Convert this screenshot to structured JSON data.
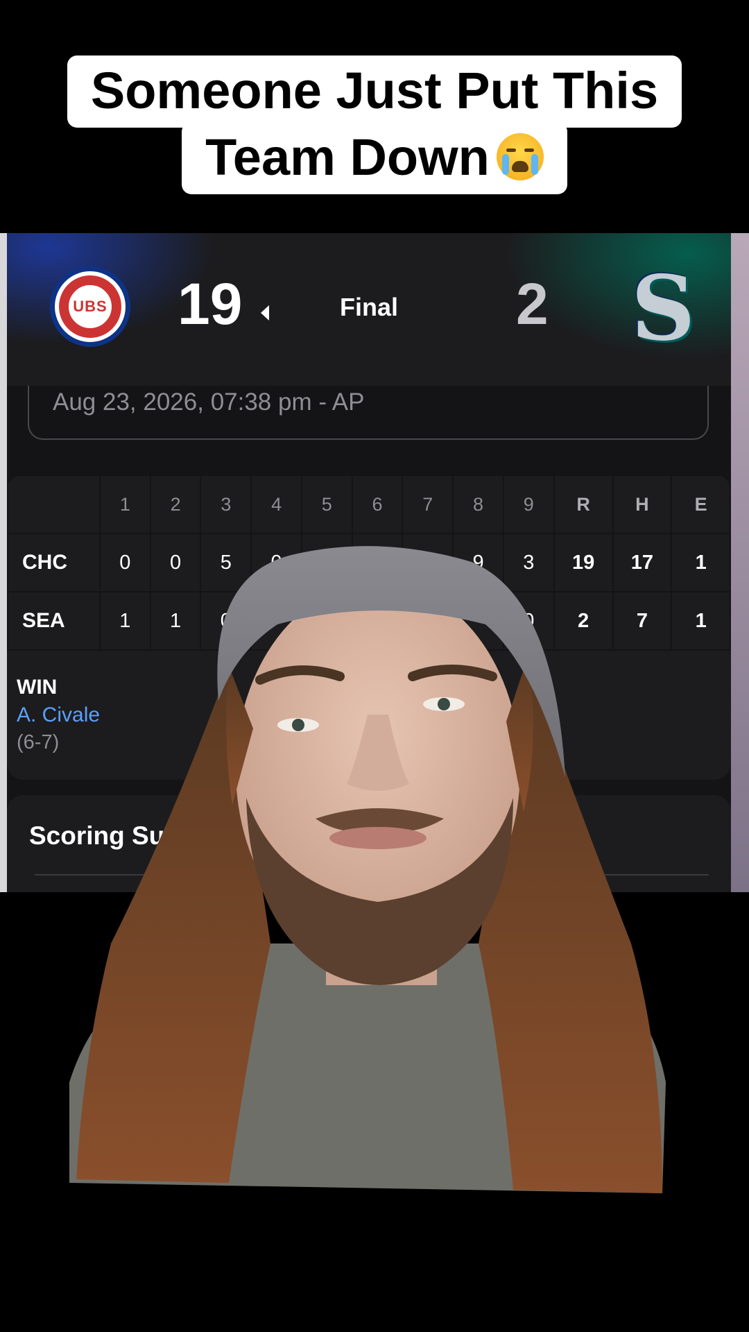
{
  "caption": {
    "line1": "Someone Just Put This",
    "line2": "Team Down",
    "emoji_icon": "loudly-crying-face-icon"
  },
  "game": {
    "home_team": "CHC",
    "home_logo_text": "UBS",
    "home_score": "19",
    "status": "Final",
    "away_team": "SEA",
    "away_score": "2",
    "date": "Aug 23, 2026, 07:38 pm - AP"
  },
  "linescore": {
    "headers": [
      "1",
      "2",
      "3",
      "4",
      "5",
      "6",
      "7",
      "8",
      "9",
      "R",
      "H",
      "E"
    ],
    "rows": [
      {
        "team": "CHC",
        "values": [
          "0",
          "0",
          "5",
          "0",
          "",
          "",
          "",
          "9",
          "3",
          "19",
          "17",
          "1"
        ]
      },
      {
        "team": "SEA",
        "values": [
          "1",
          "1",
          "0",
          "",
          "",
          "",
          "",
          "",
          "0",
          "2",
          "7",
          "1"
        ]
      }
    ]
  },
  "pitcher": {
    "label": "WIN",
    "name": "A. Civale",
    "record": "(6-7)"
  },
  "sections": {
    "scoring_summary": "Scoring Summar"
  },
  "colors": {
    "cubs_blue": "#0e3386",
    "cubs_red": "#cc3433",
    "mariners_teal": "#005c5c",
    "link_blue": "#5aa0ff"
  }
}
